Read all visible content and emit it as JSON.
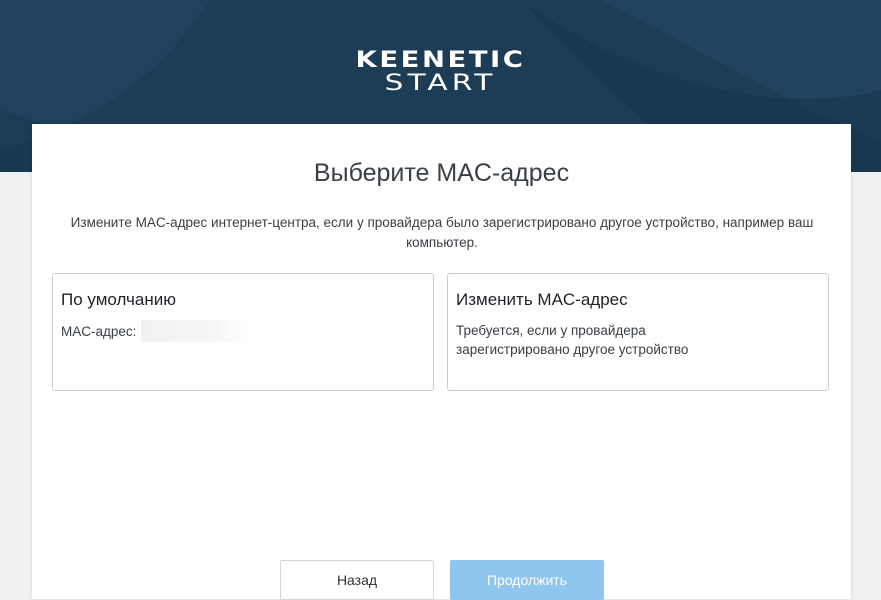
{
  "brand": {
    "line1": "KEENETIC",
    "line2": "START",
    "header_color": "#1d3c56"
  },
  "page": {
    "title": "Выберите MAC-адрес",
    "description": "Измените MAC-адрес интернет-центра, если у провайдера было зарегистрировано другое устройство, например ваш компьютер."
  },
  "options": {
    "default": {
      "title": "По умолчанию",
      "mac_label": "MAC-адрес:"
    },
    "change": {
      "title": "Изменить MAC-адрес",
      "text": "Требуется, если у провайдера зарегистрировано другое устройство"
    }
  },
  "buttons": {
    "back_label": "Назад",
    "continue_label": "Продолжить",
    "continue_color": "#8fc6ee"
  }
}
